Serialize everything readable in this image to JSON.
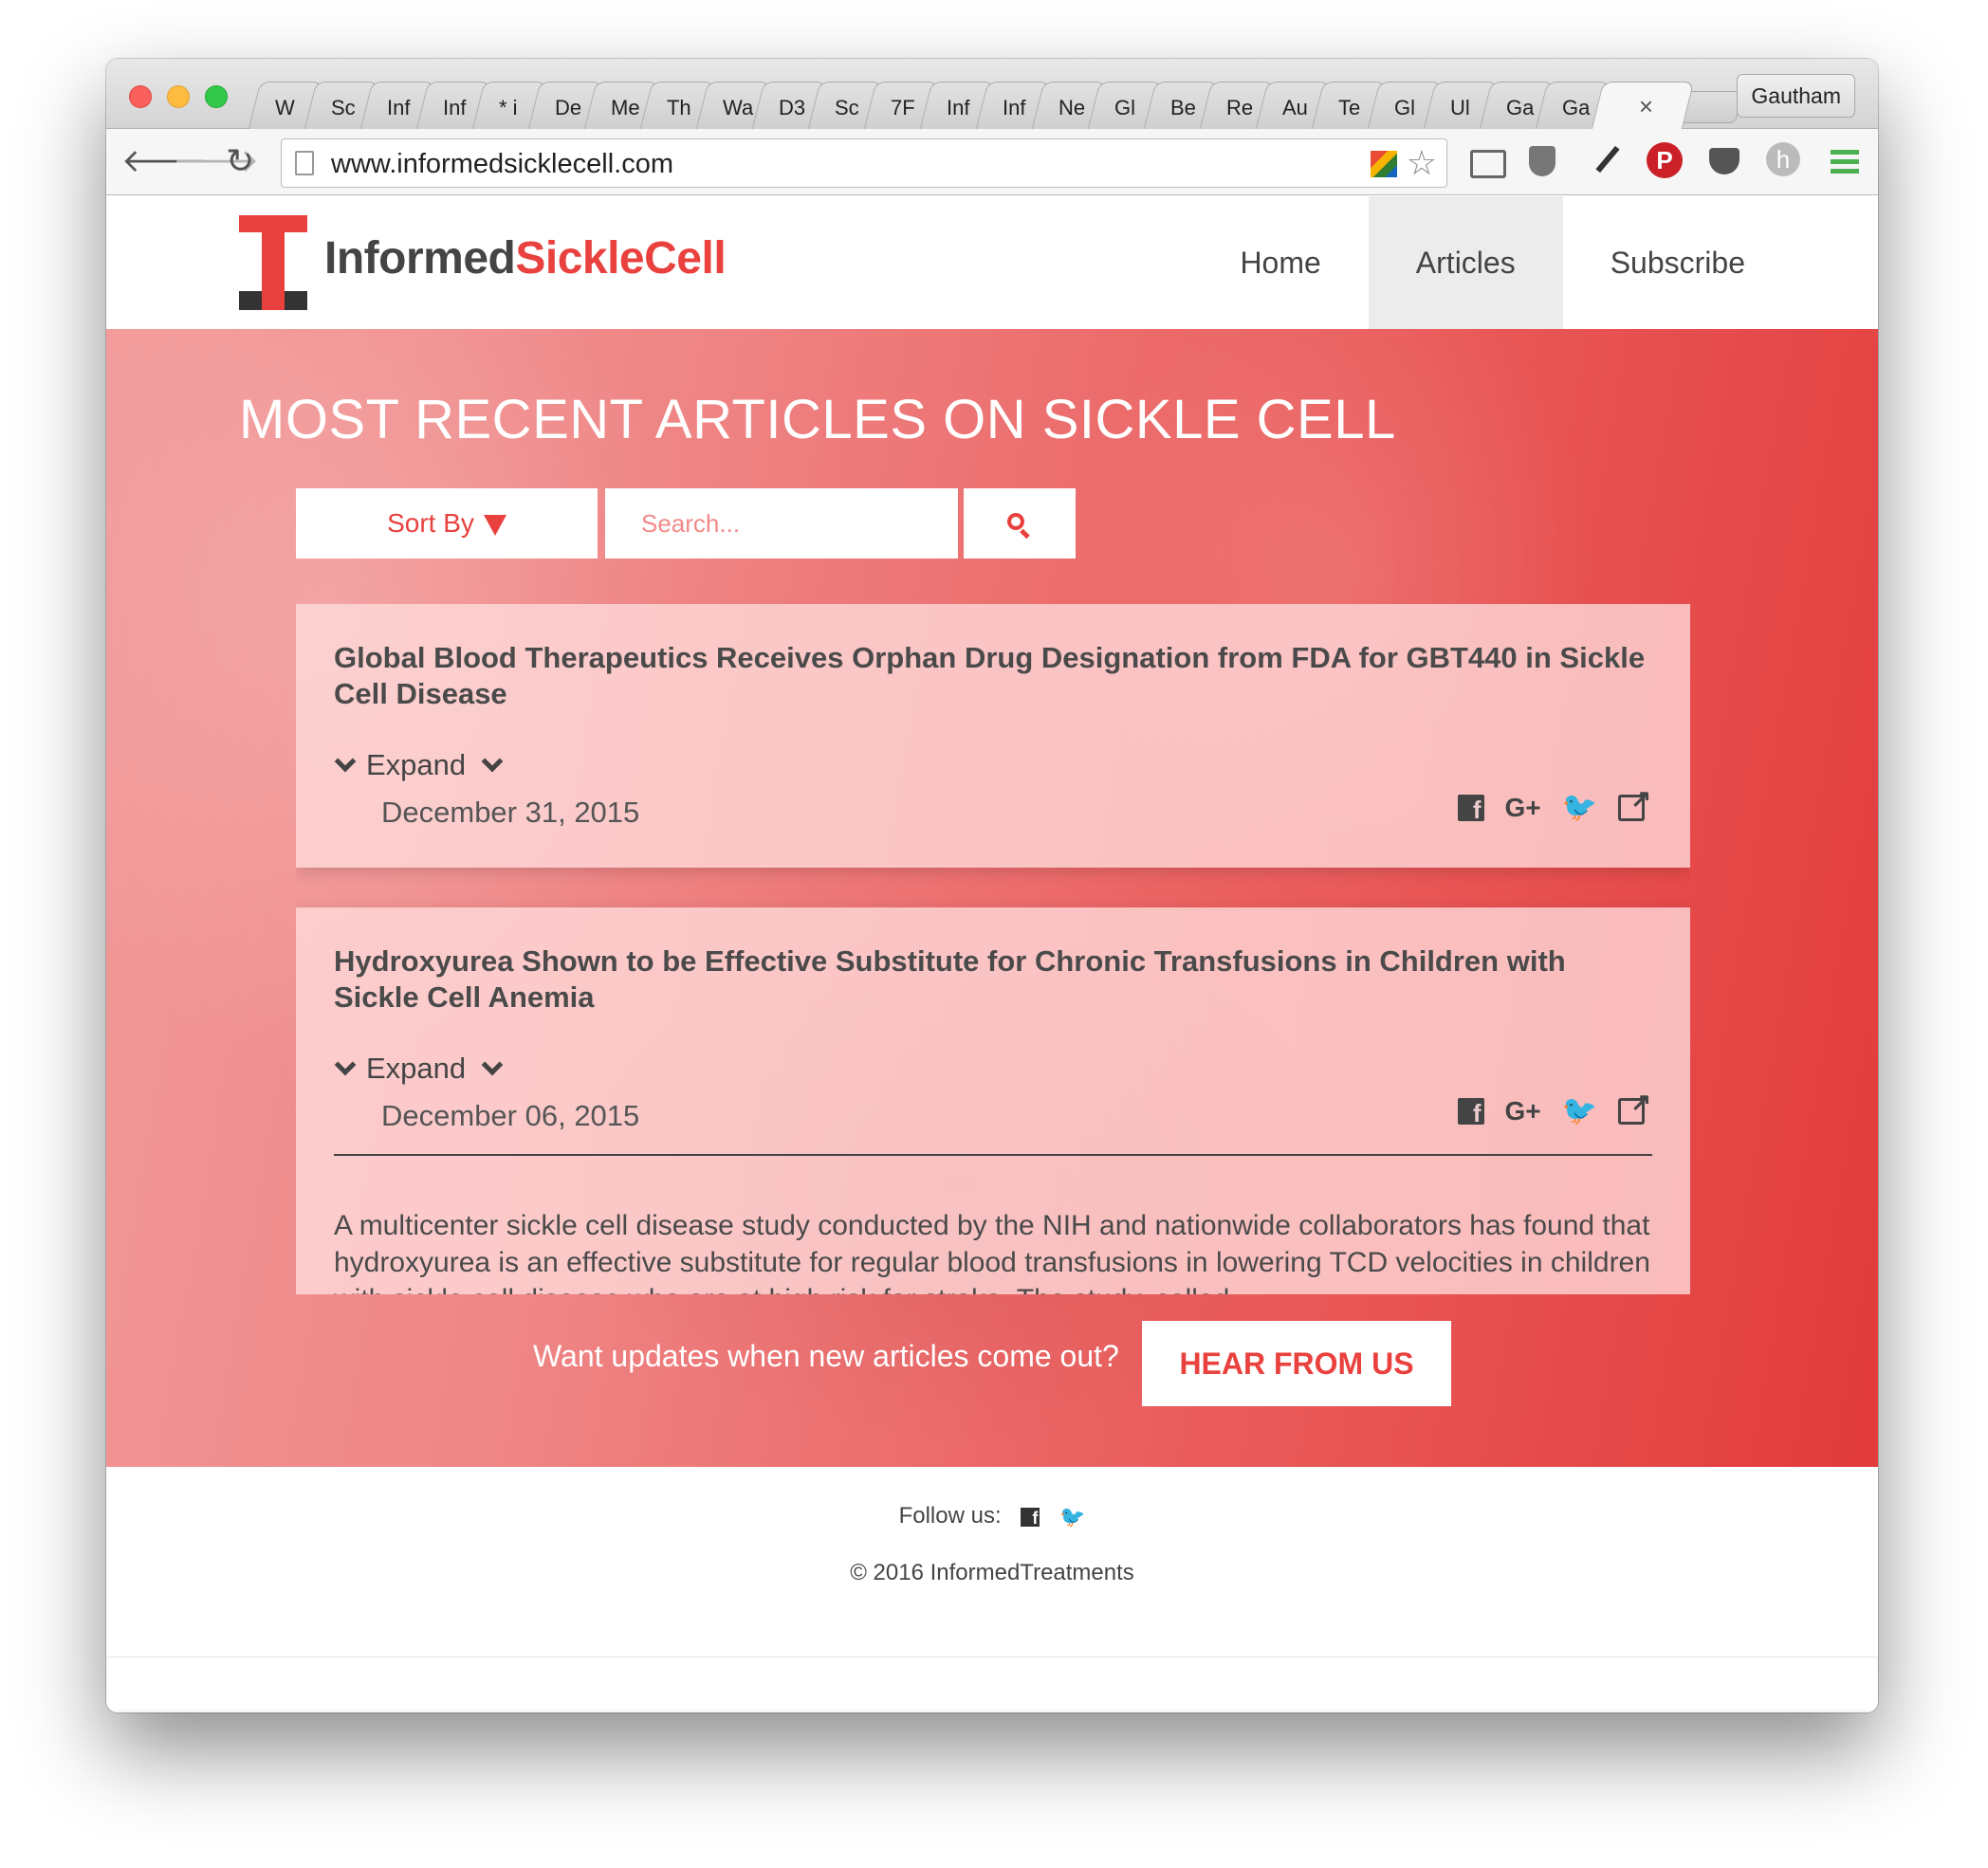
{
  "browser": {
    "tabs": [
      "W",
      "Sc",
      "Inf",
      "Inf",
      "* i",
      "De",
      "Me",
      "Th",
      "Wa",
      "D3",
      "Sc",
      "7F",
      "Inf",
      "Inf",
      "Ne",
      "Gl",
      "Be",
      "Re",
      "Au",
      "Te",
      "Gl",
      "Ul",
      "Ga",
      "Ga"
    ],
    "active_tab_close": "×",
    "profile_name": "Gautham",
    "url": "www.informedsicklecell.com",
    "icons": [
      "back-arrow-icon",
      "forward-arrow-icon",
      "reload-icon",
      "page-icon",
      "extension-icon",
      "bookmark-star-icon",
      "cast-icon",
      "ublock-icon",
      "eyedropper-icon",
      "pinterest-icon",
      "pocket-icon",
      "h-extension-icon",
      "chrome-menu-icon"
    ]
  },
  "site": {
    "brand_part1": "Informed",
    "brand_part2": "SickleCell",
    "nav": [
      {
        "label": "Home",
        "active": false
      },
      {
        "label": "Articles",
        "active": true
      },
      {
        "label": "Subscribe",
        "active": false
      }
    ],
    "accent_color": "#e8413e"
  },
  "hero": {
    "title": "MOST RECENT ARTICLES ON SICKLE CELL",
    "sort_label": "Sort By",
    "search_placeholder": "Search...",
    "search_icon": "search-icon"
  },
  "articles": [
    {
      "title": "Global Blood Therapeutics Receives Orphan Drug Designation from FDA for GBT440 in Sickle Cell Disease",
      "expand_label": "Expand",
      "date": "December 31, 2015",
      "share": {
        "fb": "f",
        "gplus": "G+",
        "tw": "🐦"
      }
    },
    {
      "title": "Hydroxyurea Shown to be Effective Substitute for Chronic Transfusions in Children with Sickle Cell Anemia",
      "expand_label": "Expand",
      "date": "December 06, 2015",
      "share": {
        "fb": "f",
        "gplus": "G+",
        "tw": "🐦"
      },
      "excerpt": "A multicenter sickle cell disease study conducted by the NIH and nationwide collaborators has found that hydroxyurea is an effective substitute for regular blood transfusions in lowering TCD velocities in children with sickle cell disease who are at high risk for stroke. The study, called"
    }
  ],
  "cta": {
    "text": "Want updates when new articles come out?",
    "button": "HEAR FROM US"
  },
  "footer": {
    "follow_label": "Follow us:",
    "fb": "f",
    "tw": "🐦",
    "copyright": "© 2016 InformedTreatments"
  }
}
